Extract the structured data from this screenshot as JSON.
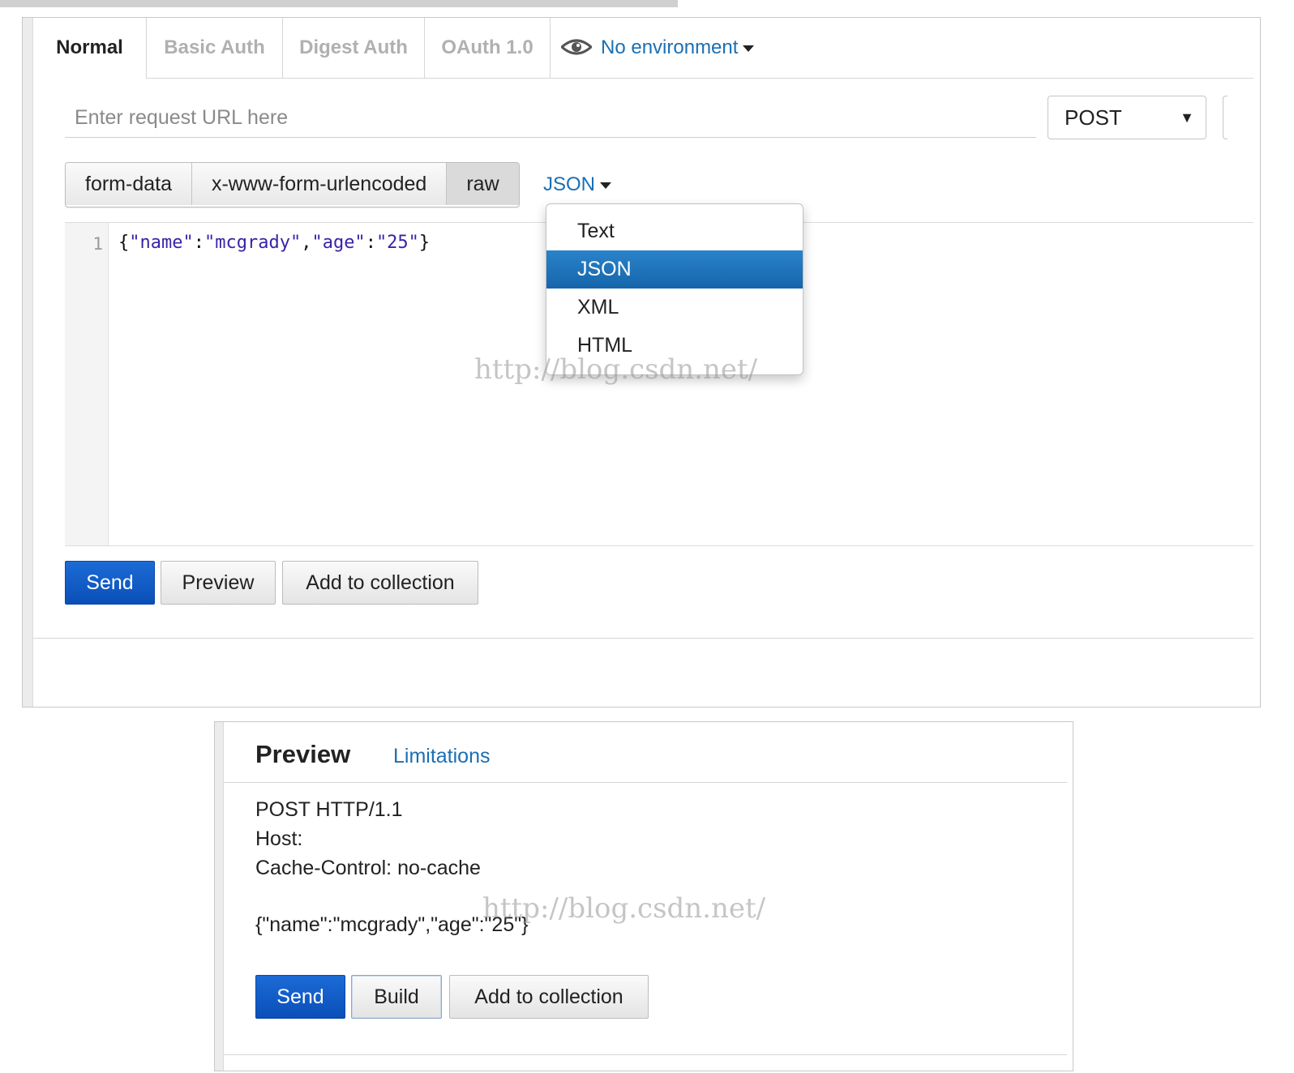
{
  "tabs": {
    "normal": "Normal",
    "basic_auth": "Basic Auth",
    "digest_auth": "Digest Auth",
    "oauth": "OAuth 1.0",
    "environment": "No environment"
  },
  "request": {
    "url_placeholder": "Enter request URL here",
    "method": "POST"
  },
  "body_types": [
    "form-data",
    "x-www-form-urlencoded",
    "raw"
  ],
  "body_type_selected": "raw",
  "language_button": "JSON",
  "dropdown": {
    "options": [
      "Text",
      "JSON",
      "XML",
      "HTML"
    ],
    "selected": "JSON"
  },
  "editor": {
    "line_number": "1",
    "tokens": [
      "{",
      "\"name\"",
      ":",
      "\"mcgrady\"",
      ",",
      "\"age\"",
      ":",
      "\"25\"",
      "}"
    ]
  },
  "actions": {
    "send": "Send",
    "preview": "Preview",
    "add_to_collection": "Add to collection"
  },
  "watermark": "http://blog.csdn.net/",
  "preview_panel": {
    "title": "Preview",
    "limitations": "Limitations",
    "lines": [
      "POST HTTP/1.1",
      "Host:",
      "Cache-Control: no-cache"
    ],
    "body": "{\"name\":\"mcgrady\",\"age\":\"25\"}",
    "send": "Send",
    "build": "Build",
    "add_to_collection": "Add to collection"
  },
  "colors": {
    "link_blue": "#1a6fb4",
    "primary_button": "#0a4fb8",
    "dropdown_selected": "#1665ab"
  }
}
